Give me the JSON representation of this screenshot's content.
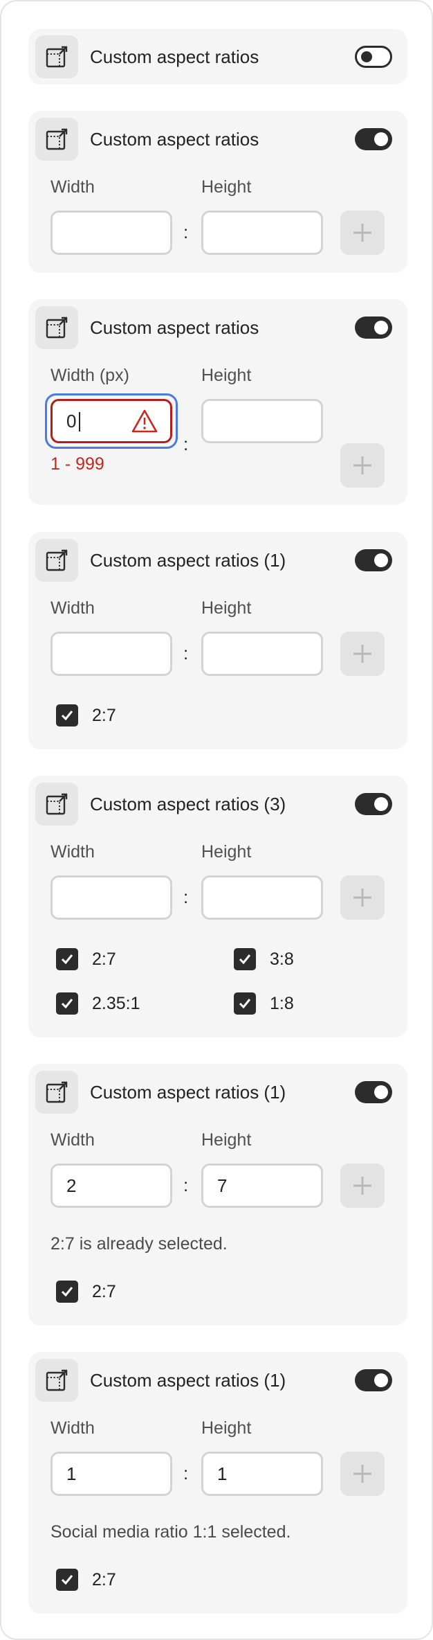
{
  "colors": {
    "accent_focus": "#4a78e8",
    "error": "#c9251c",
    "toggle_on": "#2c2c2c"
  },
  "icons": {
    "header": "aspect-ratio-crop-icon",
    "add": "plus-icon",
    "check": "checkmark-icon",
    "alert": "alert-triangle-icon"
  },
  "cards": [
    {
      "title": "Custom aspect ratios",
      "toggle_on": false
    },
    {
      "title": "Custom aspect ratios",
      "toggle_on": true,
      "width_label": "Width",
      "height_label": "Height",
      "width_value": "",
      "height_value": "",
      "separator": ":"
    },
    {
      "title": "Custom aspect ratios",
      "toggle_on": true,
      "width_label": "Width (px)",
      "height_label": "Height",
      "width_value": "0",
      "height_value": "",
      "separator": ":",
      "error_text": "1 - 999"
    },
    {
      "title": "Custom aspect ratios (1)",
      "toggle_on": true,
      "width_label": "Width",
      "height_label": "Height",
      "width_value": "",
      "height_value": "",
      "separator": ":",
      "checks": [
        "2:7"
      ]
    },
    {
      "title": "Custom aspect ratios (3)",
      "toggle_on": true,
      "width_label": "Width",
      "height_label": "Height",
      "width_value": "",
      "height_value": "",
      "separator": ":",
      "checks": [
        "2:7",
        "3:8",
        "2.35:1",
        "1:8"
      ]
    },
    {
      "title": "Custom aspect ratios (1)",
      "toggle_on": true,
      "width_label": "Width",
      "height_label": "Height",
      "width_value": "2",
      "height_value": "7",
      "separator": ":",
      "message": "2:7 is already selected.",
      "checks": [
        "2:7"
      ]
    },
    {
      "title": "Custom aspect ratios (1)",
      "toggle_on": true,
      "width_label": "Width",
      "height_label": "Height",
      "width_value": "1",
      "height_value": "1",
      "separator": ":",
      "message": "Social media ratio 1:1 selected.",
      "checks": [
        "2:7"
      ]
    }
  ]
}
